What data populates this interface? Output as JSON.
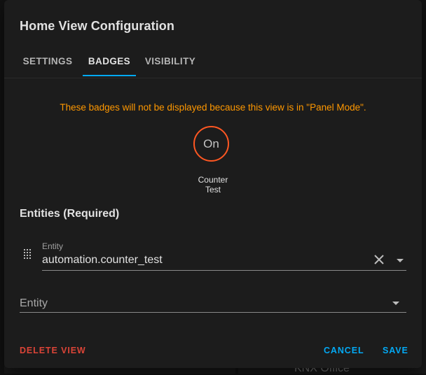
{
  "dialog": {
    "title": "Home View Configuration",
    "tabs": [
      {
        "label": "SETTINGS",
        "active": false
      },
      {
        "label": "BADGES",
        "active": true
      },
      {
        "label": "VISIBILITY",
        "active": false
      }
    ],
    "warning": "These badges will not be displayed because this view is in \"Panel Mode\".",
    "badge": {
      "state": "On",
      "label_line1": "Counter",
      "label_line2": "Test"
    },
    "entities_title": "Entities (Required)",
    "entity_field": {
      "label": "Entity",
      "value": "automation.counter_test"
    },
    "empty_entity_field": {
      "placeholder": "Entity"
    },
    "actions": {
      "delete": "DELETE VIEW",
      "cancel": "CANCEL",
      "save": "SAVE"
    }
  },
  "background": {
    "partial_text": "KNX Office"
  },
  "colors": {
    "accent": "#03a9f4",
    "warning": "#ff9800",
    "badge_border": "#ff5722",
    "danger": "#db4437"
  }
}
